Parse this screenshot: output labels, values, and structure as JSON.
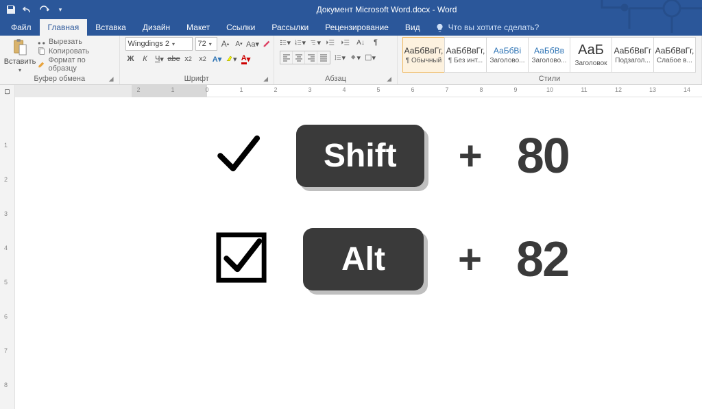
{
  "titlebar": {
    "title": "Документ Microsoft Word.docx - Word"
  },
  "tabs": {
    "file": "Файл",
    "home": "Главная",
    "insert": "Вставка",
    "design": "Дизайн",
    "layout": "Макет",
    "references": "Ссылки",
    "mailings": "Рассылки",
    "review": "Рецензирование",
    "view": "Вид",
    "tellme": "Что вы хотите сделать?"
  },
  "ribbon": {
    "clipboard": {
      "paste": "Вставить",
      "cut": "Вырезать",
      "copy": "Копировать",
      "format_painter": "Формат по образцу",
      "label": "Буфер обмена"
    },
    "font": {
      "name": "Wingdings 2",
      "size": "72",
      "label": "Шрифт"
    },
    "paragraph": {
      "label": "Абзац"
    },
    "styles": {
      "label": "Стили",
      "items": [
        {
          "preview": "АаБбВвГг,",
          "name": "¶ Обычный",
          "cls": ""
        },
        {
          "preview": "АаБбВвГг,",
          "name": "¶ Без инт...",
          "cls": ""
        },
        {
          "preview": "АаБбВі",
          "name": "Заголово...",
          "cls": "blue"
        },
        {
          "preview": "АаБбВв",
          "name": "Заголово...",
          "cls": "blue"
        },
        {
          "preview": "АаБ",
          "name": "Заголовок",
          "cls": ""
        },
        {
          "preview": "АаБбВвГг",
          "name": "Подзагол...",
          "cls": ""
        },
        {
          "preview": "АаБбВвГг,",
          "name": "Слабое в...",
          "cls": ""
        }
      ]
    }
  },
  "doc": {
    "row1": {
      "key": "Shift",
      "plus": "+",
      "code": "80"
    },
    "row2": {
      "key": "Alt",
      "plus": "+",
      "code": "82"
    }
  }
}
